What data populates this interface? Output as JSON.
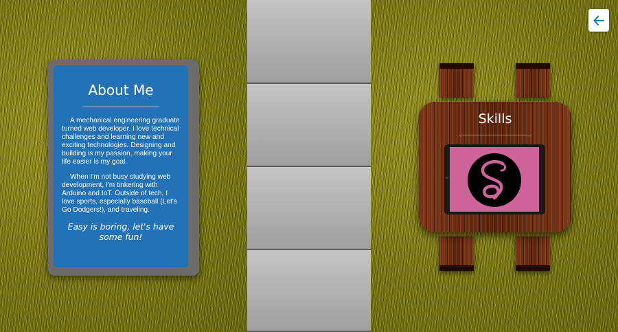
{
  "about": {
    "title": "About Me",
    "paragraph1": "A mechanical engineering graduate turned web developer. I love technical challenges and learning new and exciting technologies. Designing and building is my passion, making your life easier is my goal.",
    "paragraph2": "When I'm not busy studying web development, I'm tinkering with Arduino and IoT. Outside of tech, I love sports, especially baseball (Let's Go Dodgers!), and traveling.",
    "tagline": "Easy is boring, let's have some fun!"
  },
  "skills": {
    "title": "Skills",
    "featured_icon": "sass-logo-icon"
  },
  "navigation": {
    "back_icon": "arrow-left-icon"
  },
  "colors": {
    "about_card": "#2372b8",
    "tablet_screen": "#cf649b",
    "back_arrow": "#1d7fc4"
  }
}
